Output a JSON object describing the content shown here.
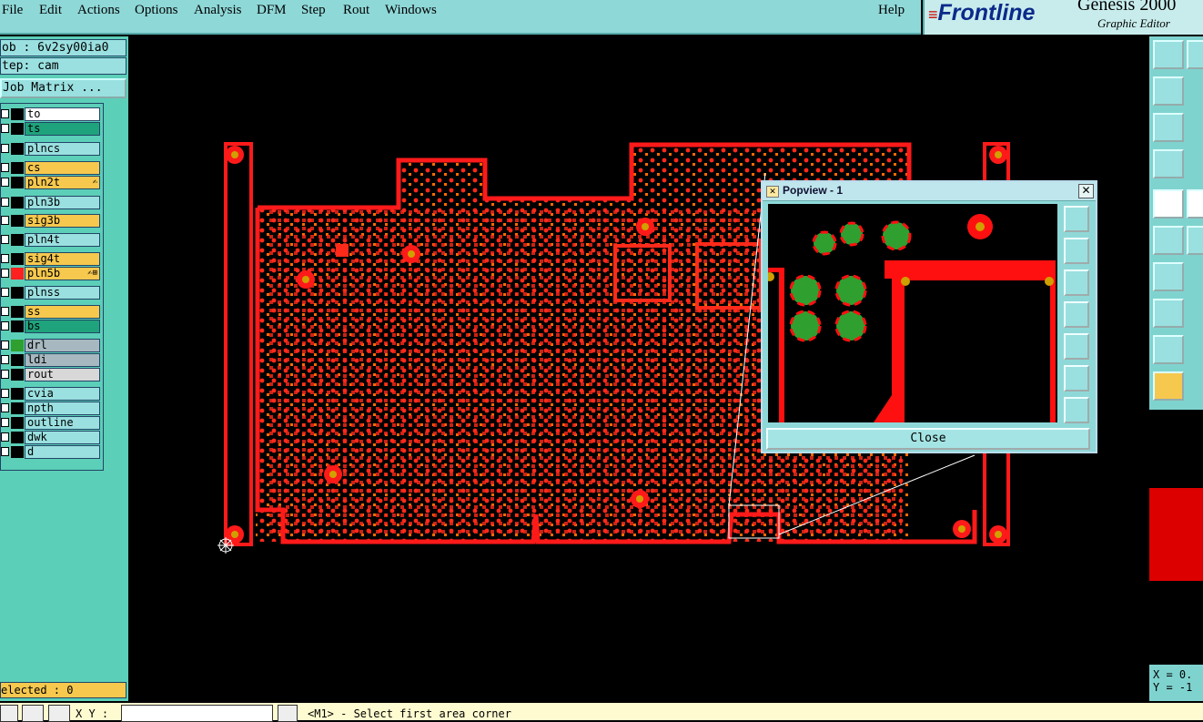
{
  "menu": {
    "items": [
      "File",
      "Edit",
      "Actions",
      "Options",
      "Analysis",
      "DFM",
      "Step",
      "Rout",
      "Windows"
    ],
    "help": "Help"
  },
  "brand": {
    "logo": "Frontline",
    "product": "Genesis 2000",
    "subtitle": "Graphic Editor"
  },
  "left": {
    "job": "ob : 6v2sy00ia0",
    "step": "tep: cam",
    "matrix_button": "Job Matrix ...",
    "layers": [
      {
        "name": "to",
        "color": "#ffffff",
        "fill": "#000000",
        "mark": ""
      },
      {
        "name": "ts",
        "color": "#1fa37c",
        "fill": "#000000",
        "mark": ""
      },
      {
        "name": "plncs",
        "color": "#9ae0e0",
        "fill": "#000000",
        "mark": ""
      },
      {
        "name": "cs",
        "color": "#f6c84e",
        "fill": "#000000",
        "mark": ""
      },
      {
        "name": "pln2t",
        "color": "#f6c84e",
        "fill": "#000000",
        "mark": "✍"
      },
      {
        "name": "pln3b",
        "color": "#9ae0e0",
        "fill": "#000000",
        "mark": ""
      },
      {
        "name": "sig3b",
        "color": "#f6c84e",
        "fill": "#000000",
        "mark": ""
      },
      {
        "name": "pln4t",
        "color": "#9ae0e0",
        "fill": "#000000",
        "mark": ""
      },
      {
        "name": "sig4t",
        "color": "#f6c84e",
        "fill": "#000000",
        "mark": ""
      },
      {
        "name": "pln5b",
        "color": "#f6c84e",
        "fill": "#ff2020",
        "mark": "✍⊞"
      },
      {
        "name": "plnss",
        "color": "#9ae0e0",
        "fill": "#000000",
        "mark": ""
      },
      {
        "name": "ss",
        "color": "#f6c84e",
        "fill": "#000000",
        "mark": ""
      },
      {
        "name": "bs",
        "color": "#1fa37c",
        "fill": "#000000",
        "mark": ""
      },
      {
        "name": "drl",
        "color": "#a8b8c0",
        "fill": "#2fa02f",
        "mark": ""
      },
      {
        "name": "ldi",
        "color": "#a8b8c0",
        "fill": "#000000",
        "mark": ""
      },
      {
        "name": "rout",
        "color": "#d8d8d8",
        "fill": "#000000",
        "mark": ""
      },
      {
        "name": "cvia",
        "color": "#9ae0e0",
        "fill": "#000000",
        "mark": ""
      },
      {
        "name": "npth",
        "color": "#9ae0e0",
        "fill": "#000000",
        "mark": ""
      },
      {
        "name": "outline",
        "color": "#9ae0e0",
        "fill": "#000000",
        "mark": ""
      },
      {
        "name": "dwk",
        "color": "#9ae0e0",
        "fill": "#000000",
        "mark": ""
      },
      {
        "name": "d",
        "color": "#9ae0e0",
        "fill": "#000000",
        "mark": ""
      }
    ],
    "selected": "elected : 0"
  },
  "popview": {
    "title": "Popview - 1",
    "close_label": "Close"
  },
  "status": {
    "xy_label": "X Y :",
    "prompt": "<M1> - Select first area corner"
  },
  "coords": {
    "x": "X = 0.",
    "y": "Y = -1"
  }
}
